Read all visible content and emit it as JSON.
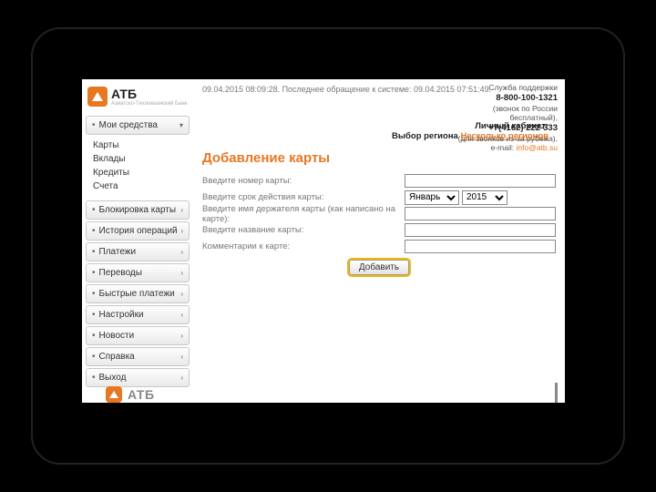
{
  "brand": {
    "name": "АТБ",
    "subtitle": "Азиатско-Тихоокеанский Банк"
  },
  "session": {
    "line": "09.04.2015 08:09:28. Последнее обращение к системе: 09.04.2015 07:51:49."
  },
  "support": {
    "title": "Служба поддержки",
    "phone1": "8-800-100-1321",
    "note1": "(звонок по России бесплатный),",
    "phone2": "+7(4162) 222-333",
    "note2": "(для звонков из-за рубежа),",
    "mail_label": "e-mail:",
    "mail": "info@atb.su"
  },
  "region": {
    "label1": "Личный кабинет:",
    "label2": "Выбор региона",
    "value": "Несколько регионов"
  },
  "sidebar": {
    "main_btn": "Мои средства",
    "sub": [
      "Карты",
      "Вклады",
      "Кредиты",
      "Счета"
    ],
    "buttons": [
      "Блокировка карты",
      "История операций",
      "Платежи",
      "Переводы",
      "Быстрые платежи",
      "Настройки",
      "Новости",
      "Справка",
      "Выход"
    ]
  },
  "page": {
    "title": "Добавление карты"
  },
  "form": {
    "card_number": "Введите номер карты:",
    "expiry": "Введите срок действия карты:",
    "holder": "Введите имя держателя карты (как написано на карте):",
    "card_name": "Введите название карты:",
    "comment": "Комментарии к карте:",
    "month": "Январь",
    "year": "2015",
    "submit": "Добавить"
  },
  "footer": {
    "bank": "АТБ"
  }
}
